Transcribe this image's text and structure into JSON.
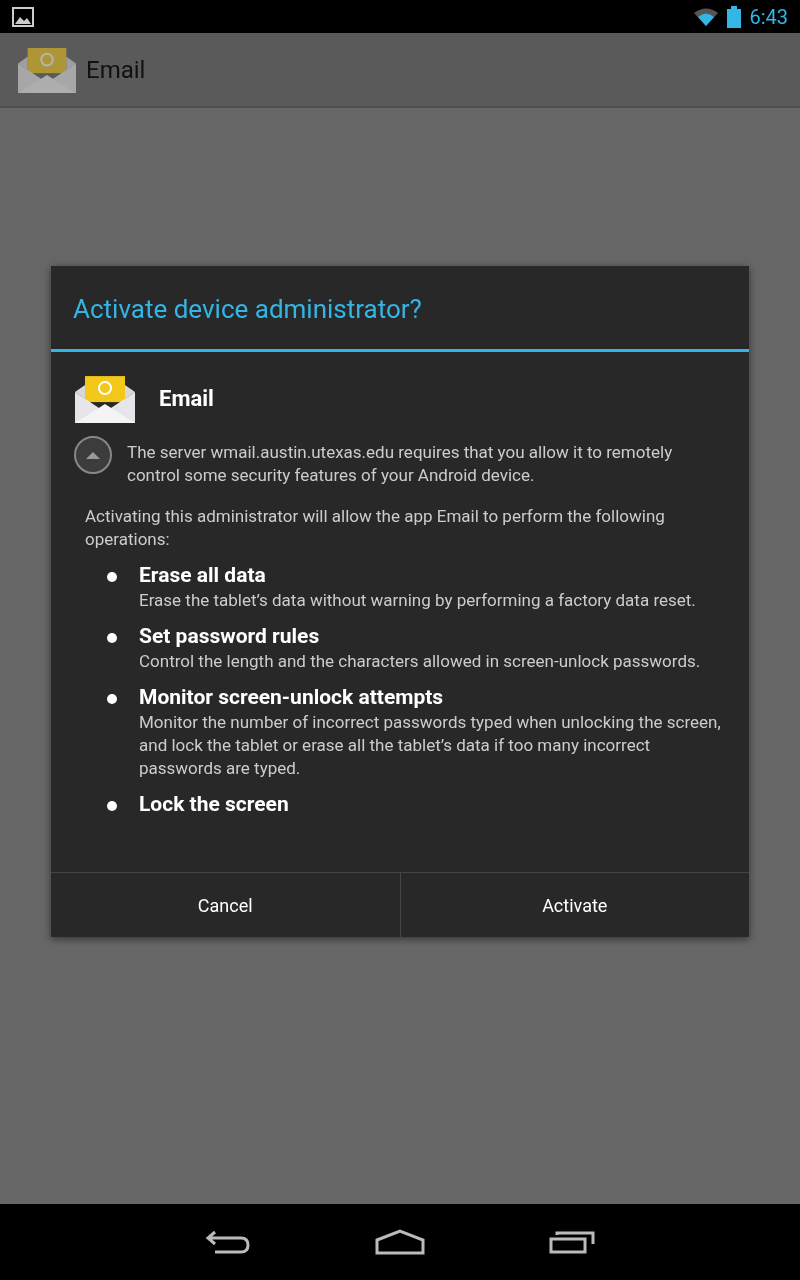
{
  "status_bar": {
    "time": "6:43"
  },
  "action_bar": {
    "title": "Email"
  },
  "dialog": {
    "title": "Activate device administrator?",
    "app_name": "Email",
    "description": "The server wmail.austin.utexas.edu requires that you allow it to remotely control some security features of your Android device.",
    "intro": "Activating this administrator will allow the app Email to perform the following operations:",
    "policies": [
      {
        "title": "Erase all data",
        "detail": "Erase the tablet’s data without warning by performing a factory data reset."
      },
      {
        "title": "Set password rules",
        "detail": "Control the length and the characters allowed in screen-unlock passwords."
      },
      {
        "title": "Monitor screen-unlock attempts",
        "detail": "Monitor the number of incorrect passwords typed when unlocking the screen, and lock the tablet or erase all the tablet’s data if too many incorrect passwords are typed."
      },
      {
        "title": "Lock the screen"
      }
    ],
    "buttons": [
      "Cancel",
      "Activate"
    ]
  }
}
